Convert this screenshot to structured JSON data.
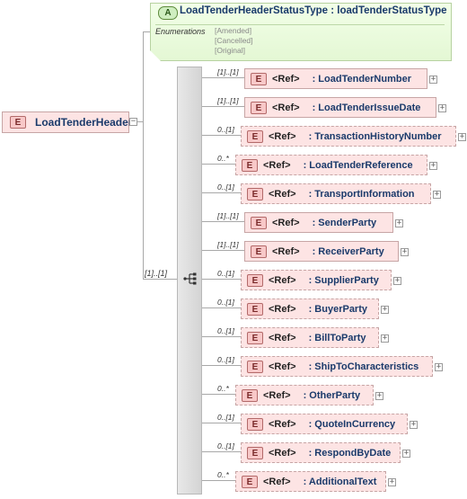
{
  "root": {
    "badge": "E",
    "name": "LoadTenderHeader",
    "collapse_glyph": "−"
  },
  "attribute": {
    "badge": "A",
    "title": "LoadTenderHeaderStatusType : loadTenderStatusType",
    "enumerations_label": "Enumerations",
    "enumerations": [
      "[Amended]",
      "[Cancelled]",
      "[Original]"
    ]
  },
  "sequence": {
    "cardinality": "[1]..[1]"
  },
  "children": [
    {
      "cardinality": "[1]..[1]",
      "badge": "E",
      "ref": "<Ref>",
      "name": ": LoadTenderNumber",
      "optional": false,
      "expand": "+"
    },
    {
      "cardinality": "[1]..[1]",
      "badge": "E",
      "ref": "<Ref>",
      "name": ": LoadTenderIssueDate",
      "optional": false,
      "expand": "+"
    },
    {
      "cardinality": "0..[1]",
      "badge": "E",
      "ref": "<Ref>",
      "name": ": TransactionHistoryNumber",
      "optional": true,
      "expand": "+"
    },
    {
      "cardinality": "0..*",
      "badge": "E",
      "ref": "<Ref>",
      "name": ": LoadTenderReference",
      "optional": true,
      "expand": "+"
    },
    {
      "cardinality": "0..[1]",
      "badge": "E",
      "ref": "<Ref>",
      "name": ": TransportInformation",
      "optional": true,
      "expand": "+"
    },
    {
      "cardinality": "[1]..[1]",
      "badge": "E",
      "ref": "<Ref>",
      "name": ": SenderParty",
      "optional": false,
      "expand": "+"
    },
    {
      "cardinality": "[1]..[1]",
      "badge": "E",
      "ref": "<Ref>",
      "name": ": ReceiverParty",
      "optional": false,
      "expand": "+"
    },
    {
      "cardinality": "0..[1]",
      "badge": "E",
      "ref": "<Ref>",
      "name": ": SupplierParty",
      "optional": true,
      "expand": "+"
    },
    {
      "cardinality": "0..[1]",
      "badge": "E",
      "ref": "<Ref>",
      "name": ": BuyerParty",
      "optional": true,
      "expand": "+"
    },
    {
      "cardinality": "0..[1]",
      "badge": "E",
      "ref": "<Ref>",
      "name": ": BillToParty",
      "optional": true,
      "expand": "+"
    },
    {
      "cardinality": "0..[1]",
      "badge": "E",
      "ref": "<Ref>",
      "name": ": ShipToCharacteristics",
      "optional": true,
      "expand": "+"
    },
    {
      "cardinality": "0..*",
      "badge": "E",
      "ref": "<Ref>",
      "name": ": OtherParty",
      "optional": true,
      "expand": "+"
    },
    {
      "cardinality": "0..[1]",
      "badge": "E",
      "ref": "<Ref>",
      "name": ": QuoteInCurrency",
      "optional": true,
      "expand": "+"
    },
    {
      "cardinality": "0..[1]",
      "badge": "E",
      "ref": "<Ref>",
      "name": ": RespondByDate",
      "optional": true,
      "expand": "+"
    },
    {
      "cardinality": "0..*",
      "badge": "E",
      "ref": "<Ref>",
      "name": ": AdditionalText",
      "optional": true,
      "expand": "+"
    }
  ]
}
